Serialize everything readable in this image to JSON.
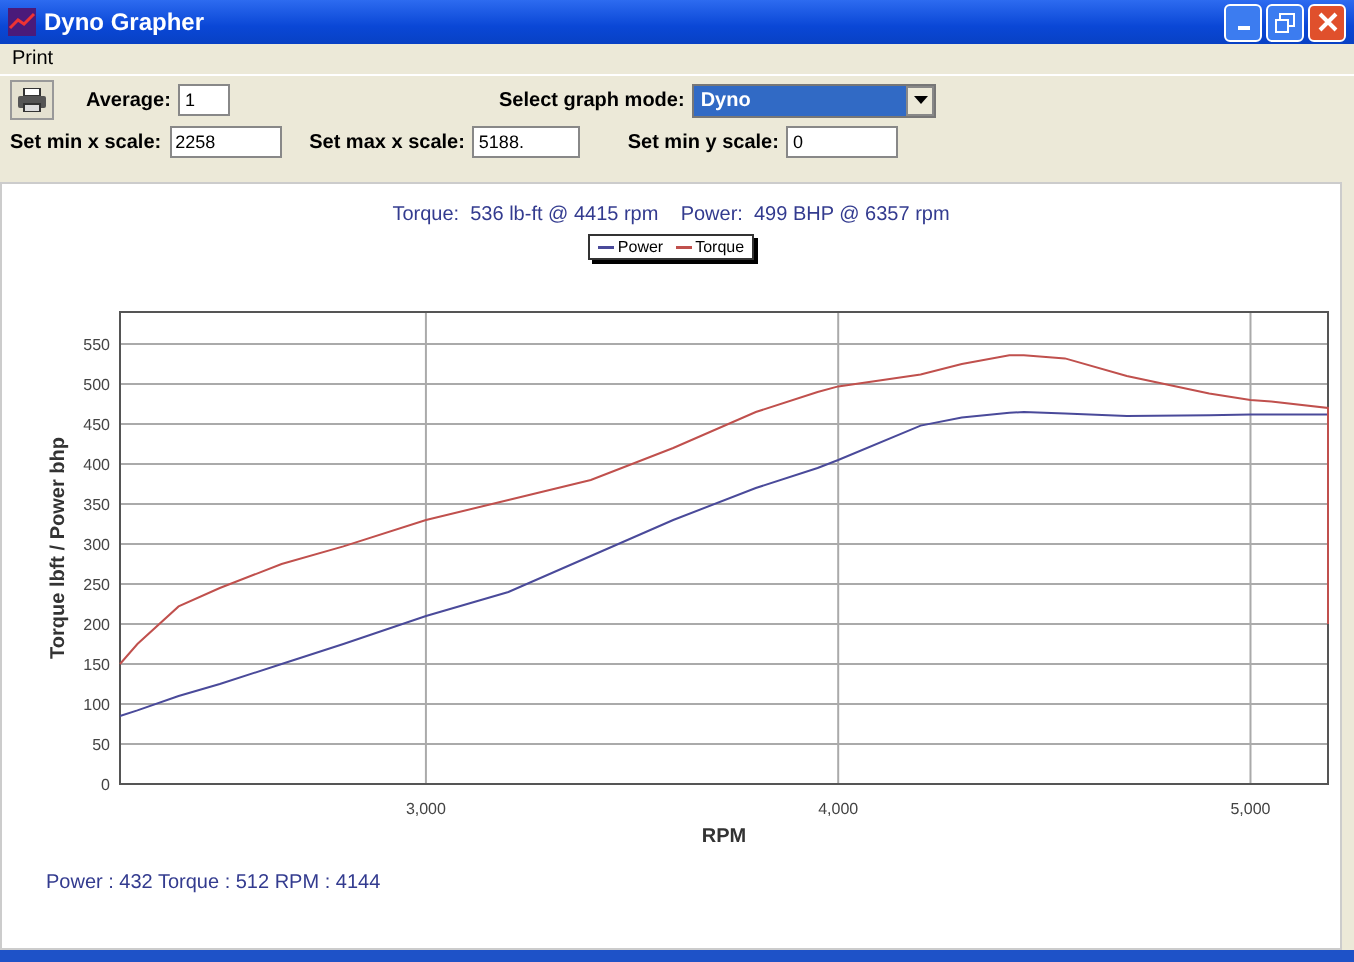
{
  "window": {
    "title": "Dyno Grapher"
  },
  "menu": [
    "Print"
  ],
  "controls": {
    "average": {
      "label": "Average:",
      "value": "1"
    },
    "graph_mode": {
      "label": "Select graph mode:",
      "value": "Dyno"
    },
    "min_x": {
      "label": "Set min x scale:",
      "value": "2258"
    },
    "max_x": {
      "label": "Set max x scale:",
      "value": "5188."
    },
    "min_y": {
      "label": "Set min y scale:",
      "value": "0"
    }
  },
  "chart": {
    "summary": "Torque:  536 lb-ft @ 4415 rpm    Power:  499 BHP @ 6357 rpm",
    "chart_data": {
      "type": "line",
      "xlabel": "RPM",
      "ylabel": "Torque lbft / Power bhp",
      "x": [
        2258,
        2300,
        2400,
        2500,
        2650,
        2800,
        3000,
        3200,
        3400,
        3600,
        3800,
        3950,
        4000,
        4200,
        4300,
        4415,
        4450,
        4550,
        4700,
        4900,
        5000,
        5050,
        5188,
        5188
      ],
      "series": [
        {
          "name": "Power",
          "color": "#4a4a9a",
          "values": [
            85,
            92,
            110,
            125,
            150,
            175,
            210,
            240,
            285,
            330,
            370,
            395,
            405,
            448,
            458,
            464,
            465,
            463,
            460,
            461,
            462,
            462,
            462,
            null
          ]
        },
        {
          "name": "Torque",
          "color": "#c0504d",
          "values": [
            150,
            175,
            222,
            245,
            275,
            297,
            330,
            355,
            380,
            420,
            465,
            490,
            497,
            512,
            525,
            536,
            536,
            532,
            510,
            488,
            480,
            478,
            470,
            200
          ]
        }
      ],
      "grid": true,
      "xlim": [
        2258,
        5188
      ],
      "ylim": [
        0,
        590
      ],
      "xticks": [
        {
          "value": 3000,
          "label": "3,000"
        },
        {
          "value": 4000,
          "label": "4,000"
        },
        {
          "value": 5000,
          "label": "5,000"
        }
      ],
      "yticks": [
        0,
        50,
        100,
        150,
        200,
        250,
        300,
        350,
        400,
        450,
        500,
        550
      ]
    }
  },
  "status": "Power : 432  Torque : 512  RPM : 4144"
}
